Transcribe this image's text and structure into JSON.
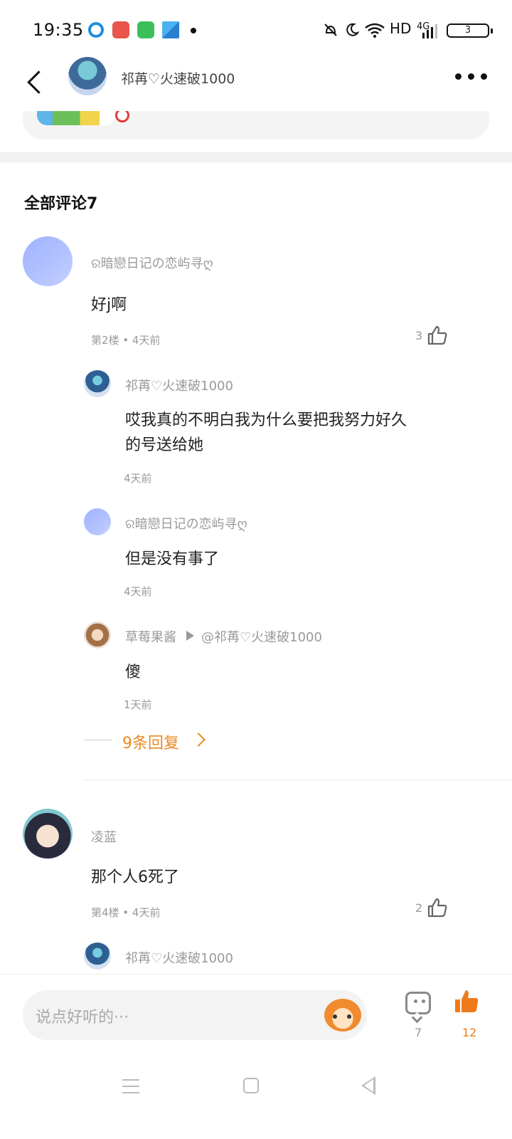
{
  "status_bar": {
    "time": "19:35",
    "hd_label": "HD",
    "network_label": "4G",
    "battery_level": "3",
    "icons": [
      "alarm-off-icon",
      "moon-icon",
      "wifi-icon",
      "signal-icon",
      "battery-icon"
    ],
    "app_icons": [
      "qq-browser-icon",
      "music-app-icon",
      "store-app-icon",
      "paper-plane-icon"
    ]
  },
  "header": {
    "author_name": "祁苒♡火速破1000",
    "back_icon": "chevron-left-icon",
    "more_icon": "more-dots-icon"
  },
  "comments_section": {
    "title": "全部评论7"
  },
  "threads": [
    {
      "comment": {
        "author": "ର暗戀日记の恋屿寻ღ",
        "text": "好j啊",
        "meta": "第2楼 • 4天前",
        "likes": "3"
      },
      "replies": [
        {
          "author": "祁苒♡火速破1000",
          "text_line1": "哎我真的不明白我为什么要把我努力好久",
          "text_line2": "的号送给她",
          "time": "4天前"
        },
        {
          "author": "ର暗戀日记の恋屿寻ღ",
          "text": "但是没有事了",
          "time": "4天前"
        },
        {
          "author": "草莓果酱",
          "reply_to": "@祁苒♡火速破1000",
          "text": "傻",
          "time": "1天前"
        }
      ],
      "more_replies": "9条回复"
    },
    {
      "comment": {
        "author": "凌蓝",
        "text": "那个人6死了",
        "meta": "第4楼 • 4天前",
        "likes": "2"
      },
      "replies": [
        {
          "author": "祁苒♡火速破1000"
        }
      ]
    }
  ],
  "bottom_bar": {
    "input_placeholder": "说点好听的···",
    "comment_count": "7",
    "like_count": "12",
    "accent_color": "#f07a1a"
  }
}
